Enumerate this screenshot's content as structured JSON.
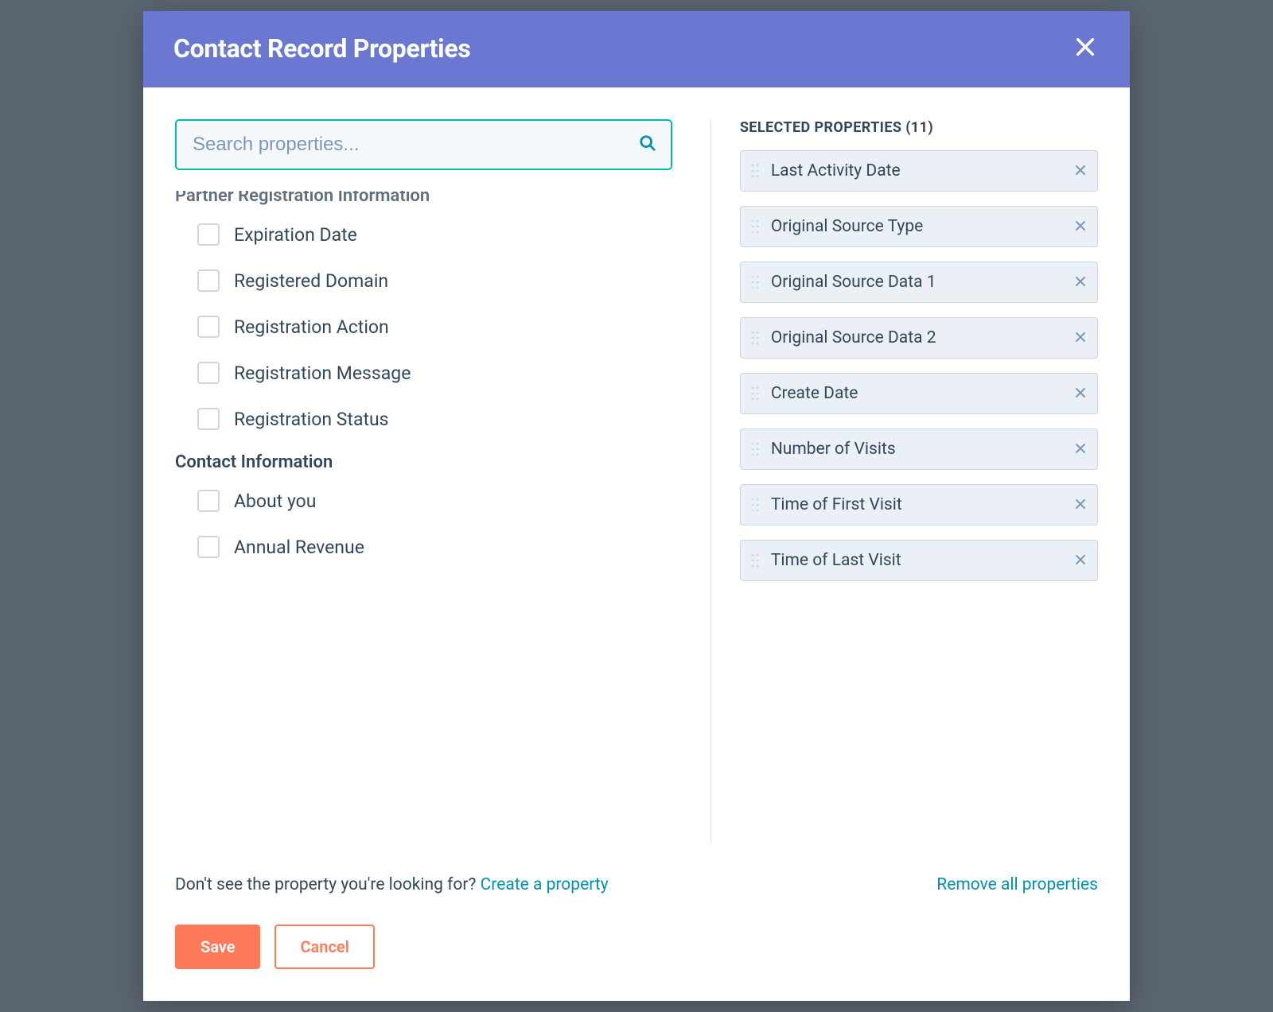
{
  "header": {
    "title": "Contact Record Properties"
  },
  "search": {
    "placeholder": "Search properties..."
  },
  "groups": [
    {
      "title": "Partner Registration Information",
      "faded": true,
      "items": [
        {
          "label": "Expiration Date"
        },
        {
          "label": "Registered Domain"
        },
        {
          "label": "Registration Action"
        },
        {
          "label": "Registration Message"
        },
        {
          "label": "Registration Status"
        }
      ]
    },
    {
      "title": "Contact Information",
      "faded": false,
      "items": [
        {
          "label": "About you"
        },
        {
          "label": "Annual Revenue"
        }
      ]
    }
  ],
  "selected_header": "SELECTED PROPERTIES (11)",
  "selected": [
    {
      "label": "Last Activity Date"
    },
    {
      "label": "Original Source Type"
    },
    {
      "label": "Original Source Data 1"
    },
    {
      "label": "Original Source Data 2"
    },
    {
      "label": "Create Date"
    },
    {
      "label": "Number of Visits"
    },
    {
      "label": "Time of First Visit"
    },
    {
      "label": "Time of Last Visit"
    }
  ],
  "footer": {
    "prompt_text": "Don't see the property you're looking for? ",
    "create_link": "Create a property",
    "remove_all": "Remove all properties",
    "save": "Save",
    "cancel": "Cancel"
  }
}
